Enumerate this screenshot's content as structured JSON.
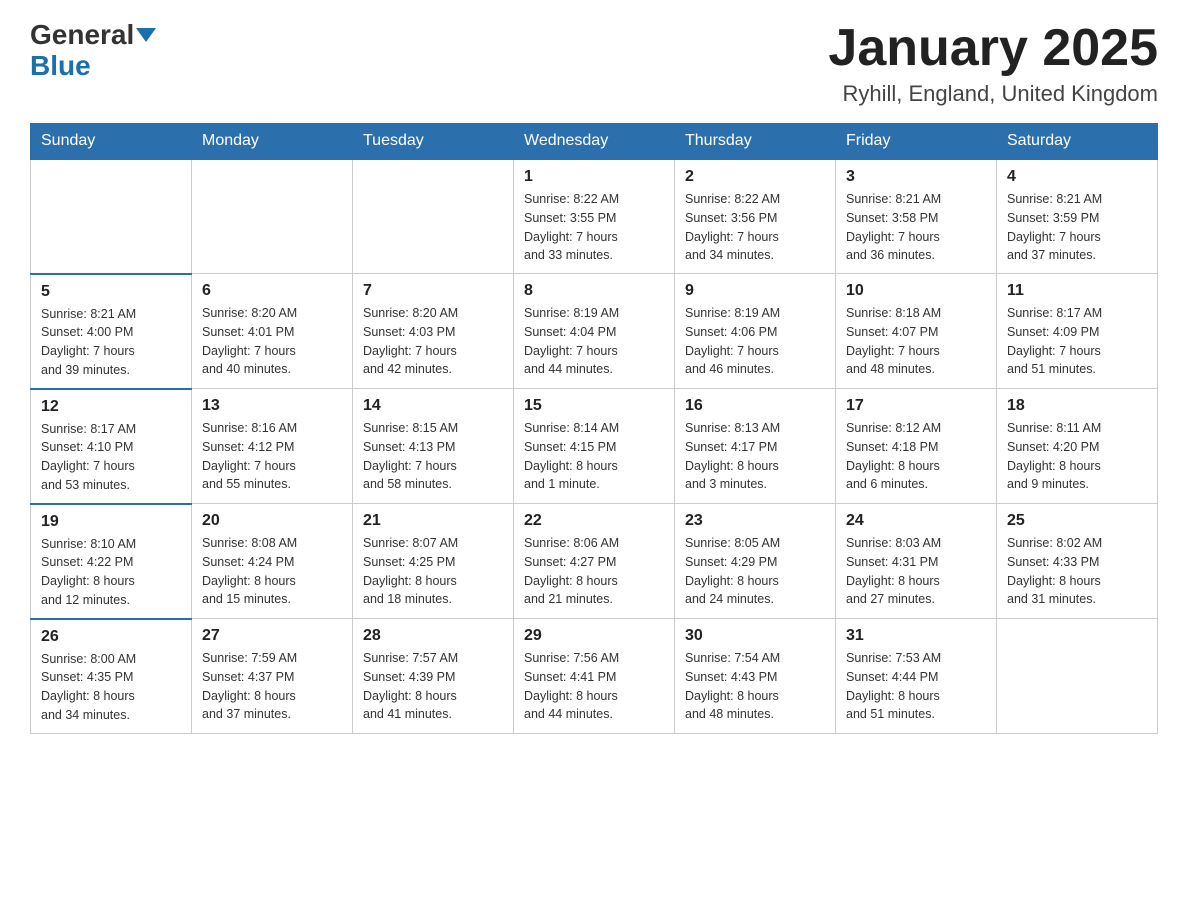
{
  "logo": {
    "text_general": "General",
    "text_blue": "Blue"
  },
  "header": {
    "month": "January 2025",
    "location": "Ryhill, England, United Kingdom"
  },
  "weekdays": [
    "Sunday",
    "Monday",
    "Tuesday",
    "Wednesday",
    "Thursday",
    "Friday",
    "Saturday"
  ],
  "weeks": [
    [
      {
        "day": "",
        "info": ""
      },
      {
        "day": "",
        "info": ""
      },
      {
        "day": "",
        "info": ""
      },
      {
        "day": "1",
        "info": "Sunrise: 8:22 AM\nSunset: 3:55 PM\nDaylight: 7 hours\nand 33 minutes."
      },
      {
        "day": "2",
        "info": "Sunrise: 8:22 AM\nSunset: 3:56 PM\nDaylight: 7 hours\nand 34 minutes."
      },
      {
        "day": "3",
        "info": "Sunrise: 8:21 AM\nSunset: 3:58 PM\nDaylight: 7 hours\nand 36 minutes."
      },
      {
        "day": "4",
        "info": "Sunrise: 8:21 AM\nSunset: 3:59 PM\nDaylight: 7 hours\nand 37 minutes."
      }
    ],
    [
      {
        "day": "5",
        "info": "Sunrise: 8:21 AM\nSunset: 4:00 PM\nDaylight: 7 hours\nand 39 minutes."
      },
      {
        "day": "6",
        "info": "Sunrise: 8:20 AM\nSunset: 4:01 PM\nDaylight: 7 hours\nand 40 minutes."
      },
      {
        "day": "7",
        "info": "Sunrise: 8:20 AM\nSunset: 4:03 PM\nDaylight: 7 hours\nand 42 minutes."
      },
      {
        "day": "8",
        "info": "Sunrise: 8:19 AM\nSunset: 4:04 PM\nDaylight: 7 hours\nand 44 minutes."
      },
      {
        "day": "9",
        "info": "Sunrise: 8:19 AM\nSunset: 4:06 PM\nDaylight: 7 hours\nand 46 minutes."
      },
      {
        "day": "10",
        "info": "Sunrise: 8:18 AM\nSunset: 4:07 PM\nDaylight: 7 hours\nand 48 minutes."
      },
      {
        "day": "11",
        "info": "Sunrise: 8:17 AM\nSunset: 4:09 PM\nDaylight: 7 hours\nand 51 minutes."
      }
    ],
    [
      {
        "day": "12",
        "info": "Sunrise: 8:17 AM\nSunset: 4:10 PM\nDaylight: 7 hours\nand 53 minutes."
      },
      {
        "day": "13",
        "info": "Sunrise: 8:16 AM\nSunset: 4:12 PM\nDaylight: 7 hours\nand 55 minutes."
      },
      {
        "day": "14",
        "info": "Sunrise: 8:15 AM\nSunset: 4:13 PM\nDaylight: 7 hours\nand 58 minutes."
      },
      {
        "day": "15",
        "info": "Sunrise: 8:14 AM\nSunset: 4:15 PM\nDaylight: 8 hours\nand 1 minute."
      },
      {
        "day": "16",
        "info": "Sunrise: 8:13 AM\nSunset: 4:17 PM\nDaylight: 8 hours\nand 3 minutes."
      },
      {
        "day": "17",
        "info": "Sunrise: 8:12 AM\nSunset: 4:18 PM\nDaylight: 8 hours\nand 6 minutes."
      },
      {
        "day": "18",
        "info": "Sunrise: 8:11 AM\nSunset: 4:20 PM\nDaylight: 8 hours\nand 9 minutes."
      }
    ],
    [
      {
        "day": "19",
        "info": "Sunrise: 8:10 AM\nSunset: 4:22 PM\nDaylight: 8 hours\nand 12 minutes."
      },
      {
        "day": "20",
        "info": "Sunrise: 8:08 AM\nSunset: 4:24 PM\nDaylight: 8 hours\nand 15 minutes."
      },
      {
        "day": "21",
        "info": "Sunrise: 8:07 AM\nSunset: 4:25 PM\nDaylight: 8 hours\nand 18 minutes."
      },
      {
        "day": "22",
        "info": "Sunrise: 8:06 AM\nSunset: 4:27 PM\nDaylight: 8 hours\nand 21 minutes."
      },
      {
        "day": "23",
        "info": "Sunrise: 8:05 AM\nSunset: 4:29 PM\nDaylight: 8 hours\nand 24 minutes."
      },
      {
        "day": "24",
        "info": "Sunrise: 8:03 AM\nSunset: 4:31 PM\nDaylight: 8 hours\nand 27 minutes."
      },
      {
        "day": "25",
        "info": "Sunrise: 8:02 AM\nSunset: 4:33 PM\nDaylight: 8 hours\nand 31 minutes."
      }
    ],
    [
      {
        "day": "26",
        "info": "Sunrise: 8:00 AM\nSunset: 4:35 PM\nDaylight: 8 hours\nand 34 minutes."
      },
      {
        "day": "27",
        "info": "Sunrise: 7:59 AM\nSunset: 4:37 PM\nDaylight: 8 hours\nand 37 minutes."
      },
      {
        "day": "28",
        "info": "Sunrise: 7:57 AM\nSunset: 4:39 PM\nDaylight: 8 hours\nand 41 minutes."
      },
      {
        "day": "29",
        "info": "Sunrise: 7:56 AM\nSunset: 4:41 PM\nDaylight: 8 hours\nand 44 minutes."
      },
      {
        "day": "30",
        "info": "Sunrise: 7:54 AM\nSunset: 4:43 PM\nDaylight: 8 hours\nand 48 minutes."
      },
      {
        "day": "31",
        "info": "Sunrise: 7:53 AM\nSunset: 4:44 PM\nDaylight: 8 hours\nand 51 minutes."
      },
      {
        "day": "",
        "info": ""
      }
    ]
  ]
}
